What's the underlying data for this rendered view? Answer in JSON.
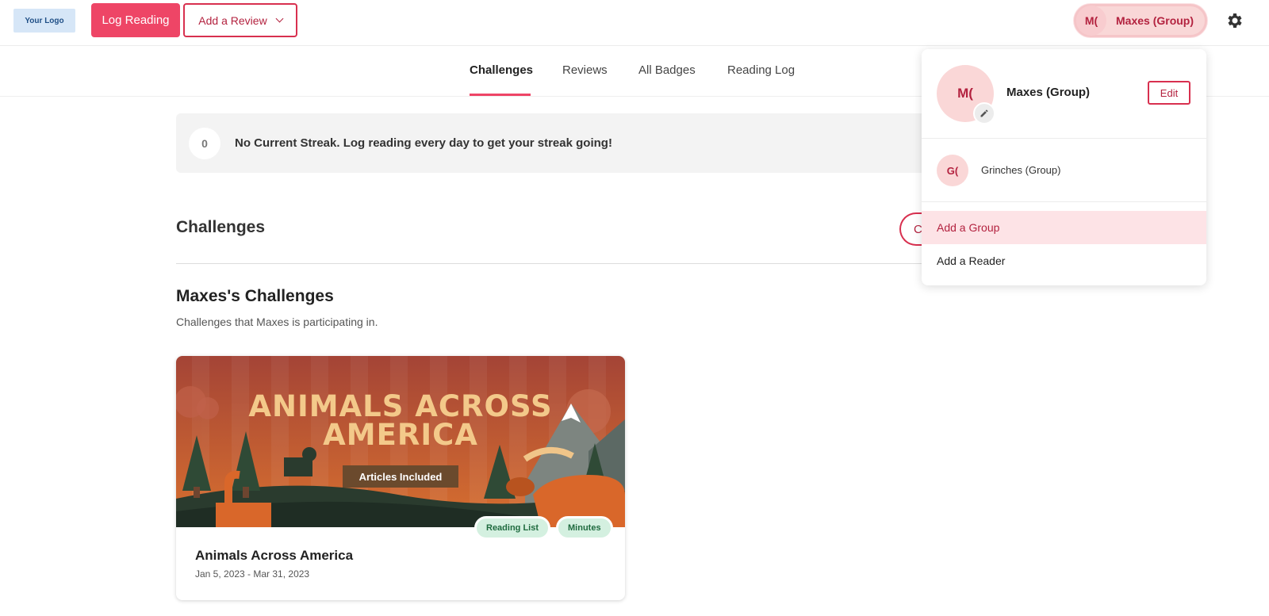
{
  "header": {
    "logo_text": "Your Logo",
    "log_reading_label": "Log Reading",
    "add_review_label": "Add a Review",
    "user_initials": "M(",
    "user_name": "Maxes (Group)"
  },
  "nav": {
    "tabs": [
      {
        "label": "Challenges",
        "active": true
      },
      {
        "label": "Reviews",
        "active": false
      },
      {
        "label": "All Badges",
        "active": false
      },
      {
        "label": "Reading Log",
        "active": false
      }
    ]
  },
  "streak": {
    "count": "0",
    "message": "No Current Streak. Log reading every day to get your streak going!"
  },
  "challenges": {
    "heading": "Challenges",
    "button_partial": "C",
    "section_title": "Maxes's Challenges",
    "section_subtitle": "Challenges that Maxes is participating in."
  },
  "card": {
    "banner_line1": "ANIMALS ACROSS",
    "banner_line2": "AMERICA",
    "banner_ribbon": "Articles Included",
    "tags": [
      "Reading List",
      "Minutes"
    ],
    "title": "Animals Across America",
    "dates": "Jan 5, 2023 - Mar 31, 2023"
  },
  "dropdown": {
    "current_initials": "M(",
    "current_name": "Maxes (Group)",
    "edit_label": "Edit",
    "other_initials": "G(",
    "other_name": "Grinches (Group)",
    "add_group_label": "Add a Group",
    "add_reader_label": "Add a Reader"
  },
  "colors": {
    "accent": "#ee4566",
    "accent_dark": "#b3223f",
    "tag_bg": "#d4f0e0",
    "tag_text": "#1f6b3f"
  },
  "icons": [
    "gear-icon",
    "chevron-down-icon",
    "pencil-icon"
  ]
}
